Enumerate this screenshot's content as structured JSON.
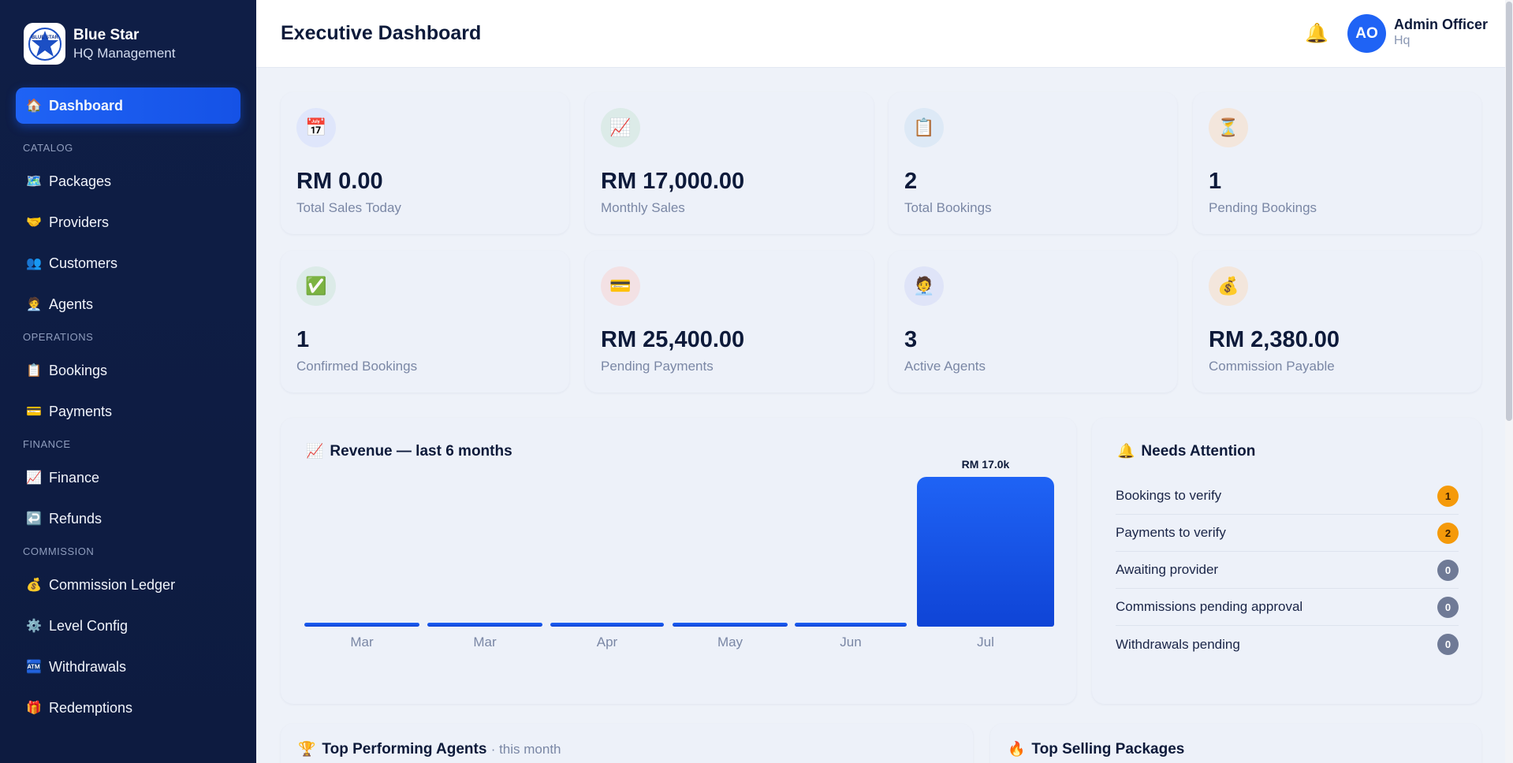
{
  "brand": {
    "name": "Blue Star",
    "subtitle": "HQ Management",
    "logo_text": "BLUE STAR"
  },
  "sidebar": {
    "active": {
      "icon": "🏠",
      "label": "Dashboard"
    },
    "sections": [
      {
        "title": "CATALOG",
        "items": [
          {
            "icon": "🗺️",
            "label": "Packages"
          },
          {
            "icon": "🤝",
            "label": "Providers"
          },
          {
            "icon": "👥",
            "label": "Customers"
          },
          {
            "icon": "🧑‍💼",
            "label": "Agents"
          }
        ]
      },
      {
        "title": "OPERATIONS",
        "items": [
          {
            "icon": "📋",
            "label": "Bookings"
          },
          {
            "icon": "💳",
            "label": "Payments"
          }
        ]
      },
      {
        "title": "FINANCE",
        "items": [
          {
            "icon": "📈",
            "label": "Finance"
          },
          {
            "icon": "↩️",
            "label": "Refunds"
          }
        ]
      },
      {
        "title": "COMMISSION",
        "items": [
          {
            "icon": "💰",
            "label": "Commission Ledger"
          },
          {
            "icon": "⚙️",
            "label": "Level Config"
          },
          {
            "icon": "🏧",
            "label": "Withdrawals"
          },
          {
            "icon": "🎁",
            "label": "Redemptions"
          }
        ]
      }
    ]
  },
  "header": {
    "title": "Executive Dashboard",
    "bell_icon": "🔔",
    "user": {
      "initials": "AO",
      "name": "Admin Officer",
      "role": "Hq"
    }
  },
  "stats": [
    {
      "icon": "📅",
      "bg": "#dfe6fb",
      "value": "RM 0.00",
      "label": "Total Sales Today"
    },
    {
      "icon": "📈",
      "bg": "#dcebe8",
      "value": "RM 17,000.00",
      "label": "Monthly Sales"
    },
    {
      "icon": "📋",
      "bg": "#dde9f6",
      "value": "2",
      "label": "Total Bookings"
    },
    {
      "icon": "⏳",
      "bg": "#f3e6dc",
      "value": "1",
      "label": "Pending Bookings"
    },
    {
      "icon": "✅",
      "bg": "#dcebe8",
      "value": "1",
      "label": "Confirmed Bookings"
    },
    {
      "icon": "💳",
      "bg": "#f3e1e4",
      "value": "RM 25,400.00",
      "label": "Pending Payments"
    },
    {
      "icon": "🧑‍💼",
      "bg": "#dfe4f8",
      "value": "3",
      "label": "Active Agents"
    },
    {
      "icon": "💰",
      "bg": "#f3e6dc",
      "value": "RM 2,380.00",
      "label": "Commission Payable"
    }
  ],
  "revenue": {
    "icon": "📈",
    "title": "Revenue — last 6 months"
  },
  "chart_data": {
    "type": "bar",
    "categories": [
      "Mar",
      "Mar",
      "Apr",
      "May",
      "Jun",
      "Jul"
    ],
    "values": [
      0,
      0,
      0,
      0,
      0,
      17000
    ],
    "data_labels": [
      "",
      "",
      "",
      "",
      "",
      "RM 17.0k"
    ],
    "ylim": [
      0,
      17000
    ],
    "grid": false,
    "color": "#1f63f5"
  },
  "attention": {
    "icon": "🔔",
    "title": "Needs Attention",
    "items": [
      {
        "label": "Bookings to verify",
        "count": "1"
      },
      {
        "label": "Payments to verify",
        "count": "2"
      },
      {
        "label": "Awaiting provider",
        "count": "0"
      },
      {
        "label": "Commissions pending approval",
        "count": "0"
      },
      {
        "label": "Withdrawals pending",
        "count": "0"
      }
    ]
  },
  "agents": {
    "icon": "🏆",
    "title": "Top Performing Agents",
    "subtitle": "· this month"
  },
  "packages": {
    "icon": "🔥",
    "title": "Top Selling Packages"
  }
}
